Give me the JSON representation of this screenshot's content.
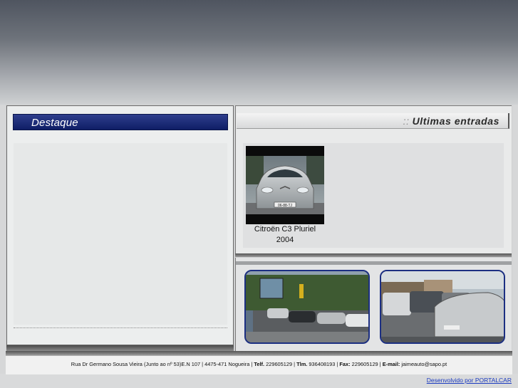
{
  "destaque": {
    "title": "Destaque"
  },
  "ultimas": {
    "separator": "::",
    "title": "Ultimas entradas"
  },
  "listing": {
    "car_name": "Citroën C3 Pluriel",
    "car_year": "2004",
    "plate": "06-88-TJ"
  },
  "footer": {
    "address": "Rua Dr Germano Sousa Vieira (Junto ao nº 53)E.N 107 | 4475-471 Nogueira | ",
    "telf_label": "Telf.",
    "telf": " 229605129 | ",
    "tlm_label": "Tlm.",
    "tlm": " 936408193 | ",
    "fax_label": "Fax:",
    "fax": " 229605129 | ",
    "email_label": "E-mail:",
    "email": " jaimeauto@sapo.pt"
  },
  "developer_link": "Desenvolvido por PORTALCAR"
}
